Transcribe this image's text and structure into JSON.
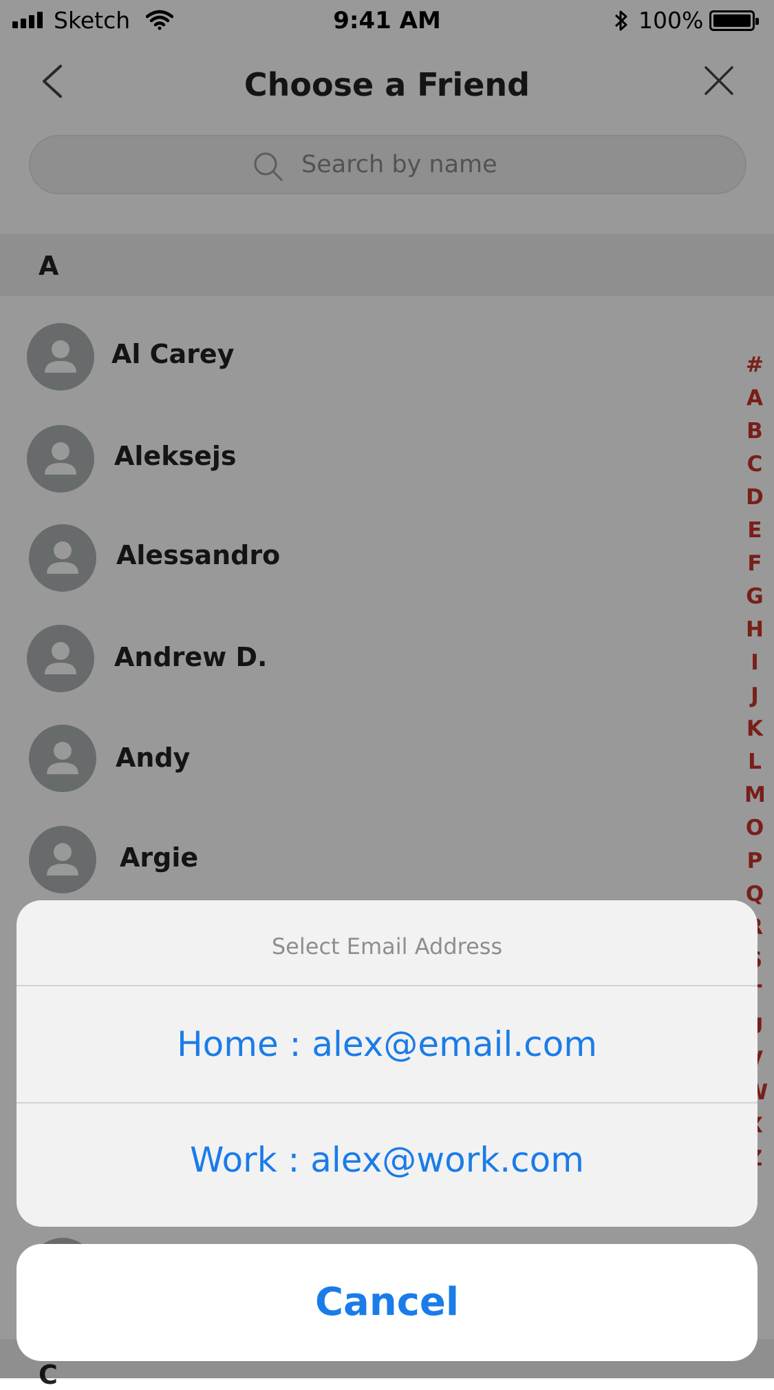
{
  "status_bar": {
    "carrier": "Sketch",
    "time": "9:41 AM",
    "battery": "100%"
  },
  "nav": {
    "title": "Choose a Friend",
    "back_icon": "chevron-left-icon",
    "close_icon": "close-icon"
  },
  "search": {
    "placeholder": "Search by name",
    "icon": "search-icon"
  },
  "sections": {
    "a": "A",
    "c": "C"
  },
  "contacts": [
    "Al Carey",
    "Aleksejs",
    "Alessandro",
    "Andrew D.",
    "Andy",
    "Argie"
  ],
  "alphabet_index": [
    "#",
    "A",
    "B",
    "C",
    "D",
    "E",
    "F",
    "G",
    "H",
    "I",
    "J",
    "K",
    "L",
    "M",
    "O",
    "P",
    "Q",
    "R",
    "S",
    "T",
    "U",
    "V",
    "W",
    "X",
    "Z"
  ],
  "action_sheet": {
    "title": "Select Email Address",
    "options": [
      "Home : alex@email.com",
      "Work : alex@work.com"
    ],
    "cancel": "Cancel"
  },
  "colors": {
    "accent": "#1a7ce8",
    "index": "#c8342a"
  }
}
